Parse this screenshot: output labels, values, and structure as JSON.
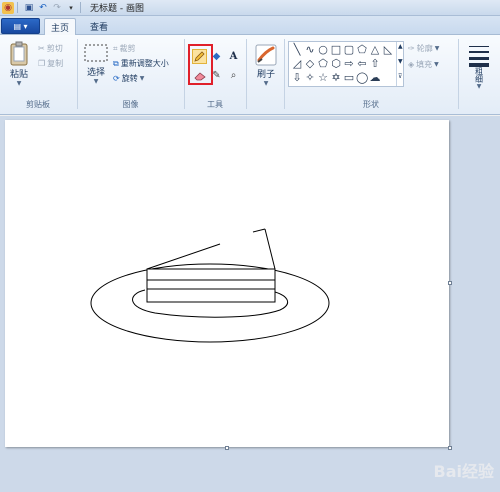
{
  "window": {
    "title": "无标题 - 画图"
  },
  "tabs": {
    "home": "主页",
    "view": "查看"
  },
  "clipboard": {
    "paste": "粘贴",
    "cut": "剪切",
    "copy": "复制",
    "label": "剪贴板"
  },
  "image": {
    "select": "选择",
    "crop": "裁剪",
    "resize": "重新调整大小",
    "rotate": "旋转",
    "label": "图像"
  },
  "tools": {
    "text_glyph": "A",
    "label": "工具"
  },
  "brushes": {
    "label": "刷子"
  },
  "shapes": {
    "outline": "轮廓",
    "fill": "填充",
    "label": "形状"
  },
  "size": {
    "label": "粗细"
  },
  "watermark": {
    "text": "Bai经验"
  },
  "colors": {
    "highlight": "#e0202a",
    "accent": "#1848a0"
  }
}
